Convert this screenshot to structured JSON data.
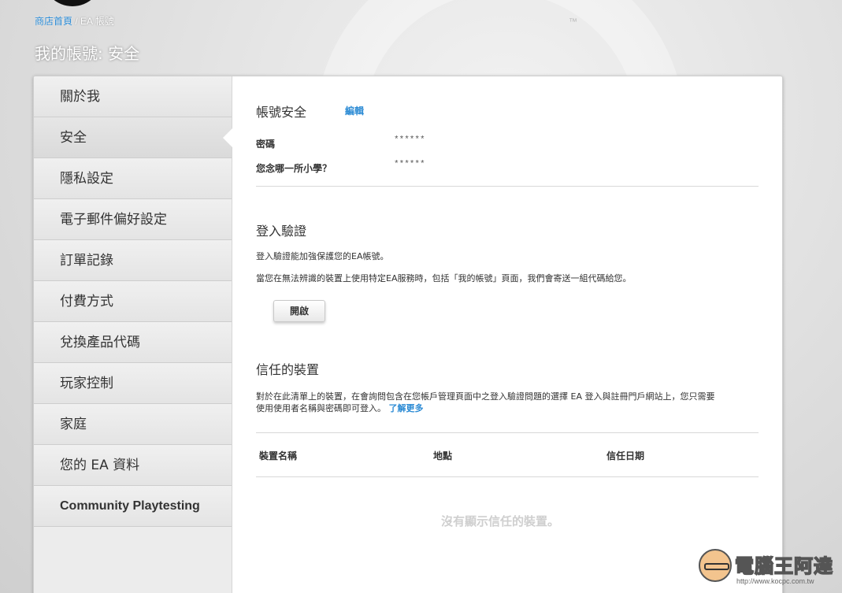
{
  "breadcrumb": {
    "home": "商店首頁",
    "separator": " / ",
    "current": "EA 帳號"
  },
  "page_title": "我的帳號: 安全",
  "background": {
    "tm": "™"
  },
  "sidebar": {
    "items": [
      {
        "label": "關於我"
      },
      {
        "label": "安全"
      },
      {
        "label": "隱私設定"
      },
      {
        "label": "電子郵件偏好設定"
      },
      {
        "label": "訂單記錄"
      },
      {
        "label": "付費方式"
      },
      {
        "label": "兌換產品代碼"
      },
      {
        "label": "玩家控制"
      },
      {
        "label": "家庭"
      },
      {
        "label": "您的 EA 資料"
      },
      {
        "label": "Community Playtesting"
      }
    ],
    "active_index": 1
  },
  "account_security": {
    "title": "帳號安全",
    "edit_label": "編輯",
    "password_label": "密碼",
    "password_value": "******",
    "question_label": "您念哪一所小學？",
    "question_value": "******"
  },
  "login_verification": {
    "title": "登入驗證",
    "line1": "登入驗證能加強保護您的EA帳號。",
    "line2": "當您在無法辨識的裝置上使用特定EA服務時，包括「我的帳號」頁面，我們會寄送一組代碼給您。",
    "enable_button": "開啟"
  },
  "trusted_devices": {
    "title": "信任的裝置",
    "desc_line1": "對於在此清單上的裝置，在會詢問包含在您帳戶管理頁面中之登入驗證問題的選擇 EA 登入與註冊門戶網站上，您只需要",
    "desc_line2": "使用使用者名稱與密碼即可登入。",
    "learn_more": "了解更多",
    "columns": [
      "裝置名稱",
      "地點",
      "信任日期"
    ],
    "empty_message": "沒有顯示信任的裝置。"
  },
  "watermark": {
    "text": "電腦王阿達",
    "url": "http://www.kocpc.com.tw"
  }
}
